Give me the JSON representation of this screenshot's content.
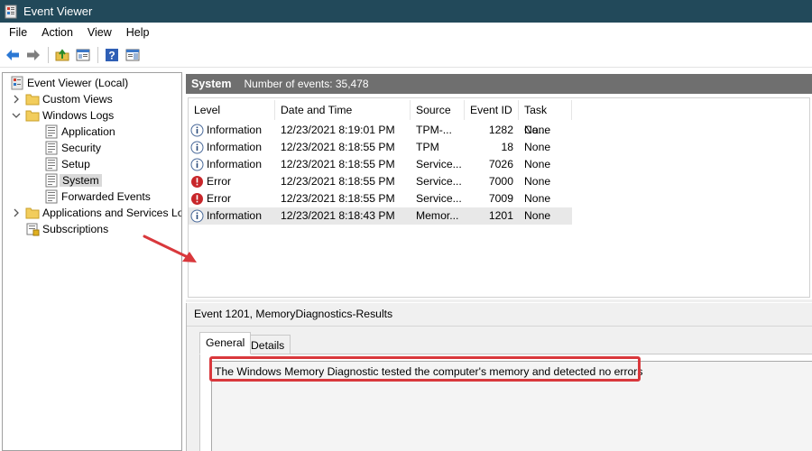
{
  "window": {
    "title": "Event Viewer",
    "app_icon": "event-viewer-icon",
    "title_bar_color": "#22495a"
  },
  "menu": [
    "File",
    "Action",
    "View",
    "Help"
  ],
  "toolbar": {
    "buttons": [
      "back-icon",
      "forward-icon",
      "up-folder-icon",
      "show-hide-tree-icon",
      "help-icon",
      "properties-icon"
    ]
  },
  "tree": {
    "items": [
      {
        "label": "Event Viewer (Local)",
        "icon": "event-viewer-icon",
        "expander": "none",
        "indent": 0
      },
      {
        "label": "Custom Views",
        "icon": "folder-icon",
        "expander": "collapsed",
        "indent": 1
      },
      {
        "label": "Windows Logs",
        "icon": "folder-icon",
        "expander": "expanded",
        "indent": 1
      },
      {
        "label": "Application",
        "icon": "log-icon",
        "expander": "none",
        "indent": 2
      },
      {
        "label": "Security",
        "icon": "log-icon",
        "expander": "none",
        "indent": 2
      },
      {
        "label": "Setup",
        "icon": "log-icon",
        "expander": "none",
        "indent": 2
      },
      {
        "label": "System",
        "icon": "log-icon",
        "expander": "none",
        "indent": 2,
        "selected": true
      },
      {
        "label": "Forwarded Events",
        "icon": "log-icon",
        "expander": "none",
        "indent": 2
      },
      {
        "label": "Applications and Services Lo",
        "icon": "folder-icon",
        "expander": "collapsed",
        "indent": 1
      },
      {
        "label": "Subscriptions",
        "icon": "subscriptions-icon",
        "expander": "none",
        "indent": 1
      }
    ]
  },
  "log_header": {
    "name": "System",
    "count_text": "Number of events: 35,478",
    "color": "#6f6f6f"
  },
  "events_table": {
    "columns": [
      "Level",
      "Date and Time",
      "Source",
      "Event ID",
      "Task Ca..."
    ],
    "rows": [
      {
        "level": "Information",
        "level_icon": "information-icon",
        "datetime": "12/23/2021 8:19:01 PM",
        "source": "TPM-...",
        "event_id": "1282",
        "task": "None"
      },
      {
        "level": "Information",
        "level_icon": "information-icon",
        "datetime": "12/23/2021 8:18:55 PM",
        "source": "TPM",
        "event_id": "18",
        "task": "None"
      },
      {
        "level": "Information",
        "level_icon": "information-icon",
        "datetime": "12/23/2021 8:18:55 PM",
        "source": "Service...",
        "event_id": "7026",
        "task": "None"
      },
      {
        "level": "Error",
        "level_icon": "error-icon",
        "datetime": "12/23/2021 8:18:55 PM",
        "source": "Service...",
        "event_id": "7000",
        "task": "None"
      },
      {
        "level": "Error",
        "level_icon": "error-icon",
        "datetime": "12/23/2021 8:18:55 PM",
        "source": "Service...",
        "event_id": "7009",
        "task": "None"
      },
      {
        "level": "Information",
        "level_icon": "information-icon",
        "datetime": "12/23/2021 8:18:43 PM",
        "source": "Memor...",
        "event_id": "1201",
        "task": "None",
        "selected": true
      }
    ]
  },
  "details": {
    "title": "Event 1201, MemoryDiagnostics-Results",
    "tabs": [
      "General",
      "Details"
    ],
    "active_tab": "General",
    "message": "The Windows Memory Diagnostic tested the computer's memory and detected no errors"
  },
  "annotations": {
    "highlight_color": "#d9383c",
    "arrow_color": "#d9383c"
  }
}
